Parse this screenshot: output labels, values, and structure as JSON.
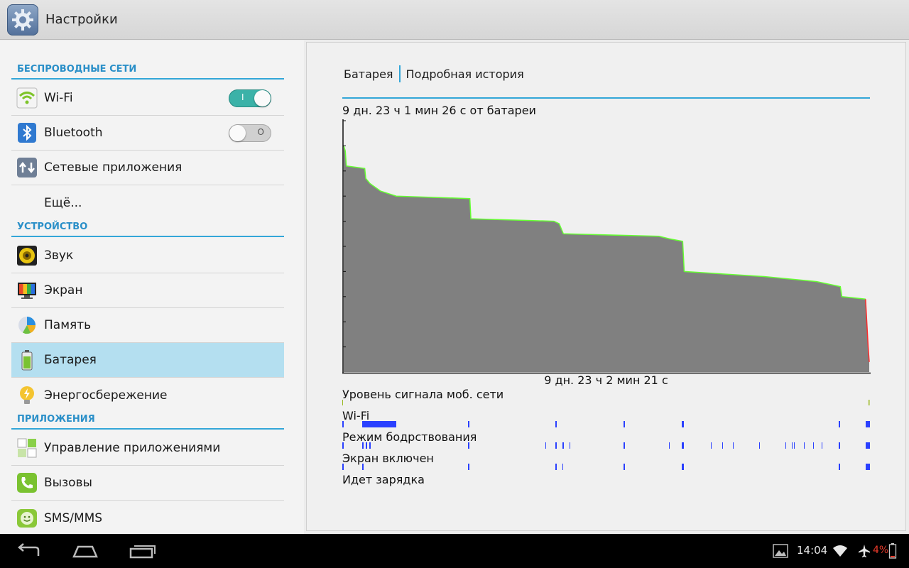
{
  "app": {
    "title": "Настройки",
    "icon": "gear-icon"
  },
  "sidebar": {
    "wireless": {
      "header": "БЕСПРОВОДНЫЕ СЕТИ",
      "items": [
        {
          "label": "Wi-Fi",
          "icon": "wifi-icon",
          "toggle": "on",
          "toggle_mark": "I"
        },
        {
          "label": "Bluetooth",
          "icon": "bluetooth-icon",
          "toggle": "off",
          "toggle_mark": "O"
        },
        {
          "label": "Сетевые приложения",
          "icon": "network-apps-icon"
        },
        {
          "label": "Ещё..."
        }
      ]
    },
    "device": {
      "header": "УСТРОЙСТВО",
      "items": [
        {
          "label": "Звук",
          "icon": "speaker-icon"
        },
        {
          "label": "Экран",
          "icon": "display-icon"
        },
        {
          "label": "Память",
          "icon": "storage-pie-icon"
        },
        {
          "label": "Батарея",
          "icon": "battery-icon",
          "selected": true
        },
        {
          "label": "Энергосбережение",
          "icon": "power-saving-bulb-icon"
        }
      ]
    },
    "apps": {
      "header": "ПРИЛОЖЕНИЯ",
      "items": [
        {
          "label": "Управление приложениями",
          "icon": "app-manager-icon"
        },
        {
          "label": "Вызовы",
          "icon": "phone-icon"
        },
        {
          "label": "SMS/MMS",
          "icon": "sms-smiley-icon"
        }
      ]
    }
  },
  "main": {
    "breadcrumb": {
      "parent": "Батарея",
      "current": "Подробная история"
    },
    "on_battery_time": "9 дн. 23 ч 1 мин 26 с от батареи",
    "chart_time": "9 дн. 23 ч 2 мин 21 с",
    "tracks": [
      {
        "label": "Уровень сигнала моб. сети"
      },
      {
        "label": "Wi-Fi"
      },
      {
        "label": "Режим бодрствования"
      },
      {
        "label": "Экран включен"
      },
      {
        "label": "Идет зарядка"
      }
    ]
  },
  "chart_data": {
    "type": "area",
    "title": "9 дн. 23 ч 1 мин 26 с от батареи",
    "xlabel": "9 дн. 23 ч 2 мин 21 с",
    "ylabel": "",
    "x_range": [
      0,
      1
    ],
    "ylim": [
      0,
      100
    ],
    "grid": false,
    "fill_color": "#808080",
    "line_color": "#66ff33",
    "low_color": "#ff2a2a",
    "x": [
      0.0,
      0.003,
      0.005,
      0.04,
      0.042,
      0.05,
      0.07,
      0.1,
      0.24,
      0.242,
      0.4,
      0.41,
      0.418,
      0.6,
      0.62,
      0.645,
      0.648,
      0.8,
      0.9,
      0.945,
      0.948,
      0.993,
      0.998,
      1.0
    ],
    "y": [
      90,
      88,
      82,
      81,
      77,
      75,
      72,
      70,
      69,
      61,
      60,
      59,
      55,
      54,
      53,
      52,
      40,
      38,
      36,
      34,
      30,
      29,
      10,
      4
    ],
    "colors": {
      "accent": "#33a6d8",
      "selected_row": "#b4dff0",
      "toggle_on": "#3bb2a8",
      "wifi_track": "#2a40ff",
      "low_battery_text": "#e83a2a"
    }
  },
  "navbar": {
    "buttons": [
      {
        "name": "back-button",
        "icon": "back-arrow-icon"
      },
      {
        "name": "home-button",
        "icon": "home-icon"
      },
      {
        "name": "recent-apps-button",
        "icon": "recent-apps-icon"
      }
    ],
    "status": {
      "clock": "14:04",
      "battery_percent": "4%",
      "icons": [
        "gallery-notification-icon",
        "wifi-signal-icon",
        "airplane-mode-icon",
        "battery-low-icon"
      ]
    }
  }
}
